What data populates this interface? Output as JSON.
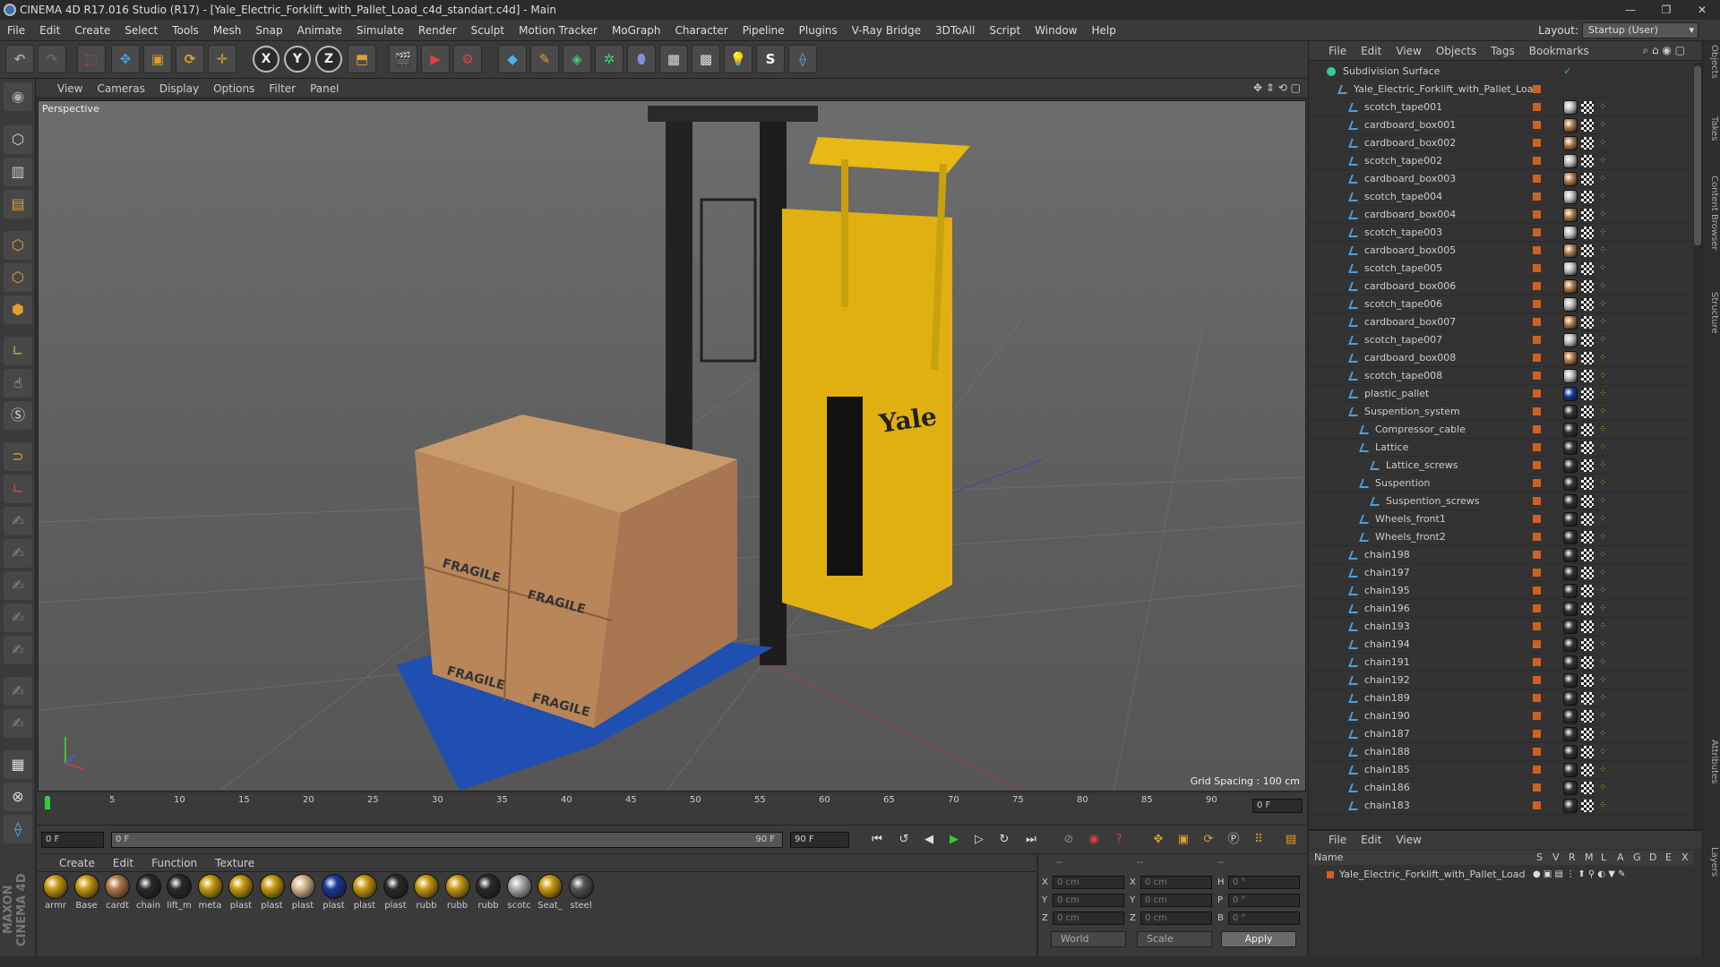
{
  "window": {
    "title": "CINEMA 4D R17.016 Studio (R17) - [Yale_Electric_Forklift_with_Pallet_Load_c4d_standart.c4d] - Main",
    "min": "—",
    "max": "❐",
    "close": "✕"
  },
  "menubar": {
    "items": [
      "File",
      "Edit",
      "Create",
      "Select",
      "Tools",
      "Mesh",
      "Snap",
      "Animate",
      "Simulate",
      "Render",
      "Sculpt",
      "Motion Tracker",
      "MoGraph",
      "Character",
      "Pipeline",
      "Plugins",
      "V-Ray Bridge",
      "3DToAll",
      "Script",
      "Window",
      "Help"
    ],
    "layout_label": "Layout:",
    "layout_value": "Startup (User)"
  },
  "viewport": {
    "menu": [
      "View",
      "Cameras",
      "Display",
      "Options",
      "Filter",
      "Panel"
    ],
    "label": "Perspective",
    "grid_spacing": "Grid Spacing : 100 cm",
    "fragile": "FRAGILE",
    "yale": "Yale"
  },
  "timeline": {
    "ticks": [
      "0",
      "5",
      "10",
      "15",
      "20",
      "25",
      "30",
      "35",
      "40",
      "45",
      "50",
      "55",
      "60",
      "65",
      "70",
      "75",
      "80",
      "85",
      "90"
    ],
    "current_frame": "0 F"
  },
  "playbar": {
    "start": "0 F",
    "slider_start": "0 F",
    "slider_end": "90 F",
    "end": "90 F"
  },
  "materials": {
    "menu": [
      "Create",
      "Edit",
      "Function",
      "Texture"
    ],
    "items": [
      {
        "label": "armr",
        "color": "#c89a10"
      },
      {
        "label": "Base",
        "color": "#c89a10"
      },
      {
        "label": "cardt",
        "color": "#b07a48"
      },
      {
        "label": "chain",
        "color": "#2a2a2a"
      },
      {
        "label": "lift_m",
        "color": "#2a2a2a"
      },
      {
        "label": "meta",
        "color": "#c89a10"
      },
      {
        "label": "plast",
        "color": "#c89a10"
      },
      {
        "label": "plast",
        "color": "#c89a10"
      },
      {
        "label": "plast",
        "color": "#d8b890"
      },
      {
        "label": "plast",
        "color": "#1a3a9a"
      },
      {
        "label": "plast",
        "color": "#c89a10"
      },
      {
        "label": "plast",
        "color": "#2a2a2a"
      },
      {
        "label": "rubb",
        "color": "#c89a10"
      },
      {
        "label": "rubb",
        "color": "#c89a10"
      },
      {
        "label": "rubb",
        "color": "#2a2a2a"
      },
      {
        "label": "scotc",
        "color": "#aaaaaa"
      },
      {
        "label": "Seat_",
        "color": "#c89a10"
      },
      {
        "label": "steel",
        "color": "#555555"
      }
    ]
  },
  "coords": {
    "x_pos": "0 cm",
    "y_pos": "0 cm",
    "z_pos": "0 cm",
    "x_size": "0 cm",
    "y_size": "0 cm",
    "z_size": "0 cm",
    "h": "0 °",
    "p": "0 °",
    "b": "0 °",
    "dash1": "--",
    "dash2": "--",
    "dash3": "--",
    "world": "World",
    "scale": "Scale",
    "apply": "Apply"
  },
  "objects": {
    "menu": [
      "File",
      "Edit",
      "View",
      "Objects",
      "Tags",
      "Bookmarks"
    ],
    "rows": [
      {
        "name": "Subdivision Surface",
        "indent": 0,
        "mat": ""
      },
      {
        "name": "Yale_Electric_Forklift_with_Pallet_Load",
        "indent": 1,
        "mat": ""
      },
      {
        "name": "scotch_tape001",
        "indent": 2,
        "mat": "#bbbbbb"
      },
      {
        "name": "cardboard_box001",
        "indent": 2,
        "mat": "#b07a48"
      },
      {
        "name": "cardboard_box002",
        "indent": 2,
        "mat": "#b07a48"
      },
      {
        "name": "scotch_tape002",
        "indent": 2,
        "mat": "#bbbbbb"
      },
      {
        "name": "cardboard_box003",
        "indent": 2,
        "mat": "#b07a48"
      },
      {
        "name": "scotch_tape004",
        "indent": 2,
        "mat": "#bbbbbb"
      },
      {
        "name": "cardboard_box004",
        "indent": 2,
        "mat": "#b07a48"
      },
      {
        "name": "scotch_tape003",
        "indent": 2,
        "mat": "#bbbbbb"
      },
      {
        "name": "cardboard_box005",
        "indent": 2,
        "mat": "#b07a48"
      },
      {
        "name": "scotch_tape005",
        "indent": 2,
        "mat": "#bbbbbb"
      },
      {
        "name": "cardboard_box006",
        "indent": 2,
        "mat": "#b07a48"
      },
      {
        "name": "scotch_tape006",
        "indent": 2,
        "mat": "#bbbbbb"
      },
      {
        "name": "cardboard_box007",
        "indent": 2,
        "mat": "#b07a48"
      },
      {
        "name": "scotch_tape007",
        "indent": 2,
        "mat": "#bbbbbb"
      },
      {
        "name": "cardboard_box008",
        "indent": 2,
        "mat": "#b07a48"
      },
      {
        "name": "scotch_tape008",
        "indent": 2,
        "mat": "#bbbbbb"
      },
      {
        "name": "plastic_pallet",
        "indent": 2,
        "mat": "#1a3a9a"
      },
      {
        "name": "Suspention_system",
        "indent": 2,
        "mat": "#333333"
      },
      {
        "name": "Compressor_cable",
        "indent": 3,
        "mat": "#333333"
      },
      {
        "name": "Lattice",
        "indent": 3,
        "mat": "#333333"
      },
      {
        "name": "Lattice_screws",
        "indent": 4,
        "mat": "#333333"
      },
      {
        "name": "Suspention",
        "indent": 3,
        "mat": "#333333"
      },
      {
        "name": "Suspention_screws",
        "indent": 4,
        "mat": "#333333"
      },
      {
        "name": "Wheels_front1",
        "indent": 3,
        "mat": "#333333"
      },
      {
        "name": "Wheels_front2",
        "indent": 3,
        "mat": "#333333"
      },
      {
        "name": "chain198",
        "indent": 2,
        "mat": "#333333"
      },
      {
        "name": "chain197",
        "indent": 2,
        "mat": "#333333"
      },
      {
        "name": "chain195",
        "indent": 2,
        "mat": "#333333"
      },
      {
        "name": "chain196",
        "indent": 2,
        "mat": "#333333"
      },
      {
        "name": "chain193",
        "indent": 2,
        "mat": "#333333"
      },
      {
        "name": "chain194",
        "indent": 2,
        "mat": "#333333"
      },
      {
        "name": "chain191",
        "indent": 2,
        "mat": "#333333"
      },
      {
        "name": "chain192",
        "indent": 2,
        "mat": "#333333"
      },
      {
        "name": "chain189",
        "indent": 2,
        "mat": "#333333"
      },
      {
        "name": "chain190",
        "indent": 2,
        "mat": "#333333"
      },
      {
        "name": "chain187",
        "indent": 2,
        "mat": "#333333"
      },
      {
        "name": "chain188",
        "indent": 2,
        "mat": "#333333"
      },
      {
        "name": "chain185",
        "indent": 2,
        "mat": "#333333"
      },
      {
        "name": "chain186",
        "indent": 2,
        "mat": "#333333"
      },
      {
        "name": "chain183",
        "indent": 2,
        "mat": "#333333"
      }
    ]
  },
  "layers": {
    "menu": [
      "File",
      "Edit",
      "View"
    ],
    "header_name": "Name",
    "header_cols": [
      "S",
      "V",
      "R",
      "M",
      "L",
      "A",
      "G",
      "D",
      "E",
      "X"
    ],
    "row": "Yale_Electric_Forklift_with_Pallet_Load"
  },
  "sidetabs": [
    "Objects",
    "Takes",
    "Content Browser",
    "Structure",
    "Attributes",
    "Layers"
  ],
  "brand": "MAXON CINEMA 4D"
}
